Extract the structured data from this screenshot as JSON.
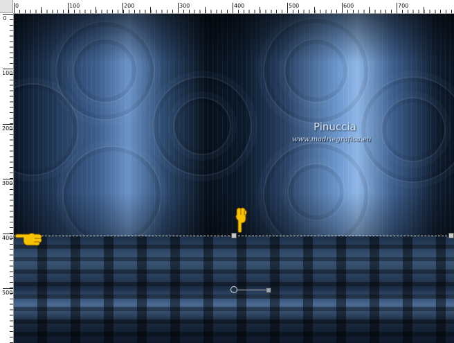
{
  "rulers": {
    "top_labels": [
      "0",
      "100",
      "200",
      "300",
      "400",
      "500",
      "600",
      "700"
    ],
    "left_labels": [
      "0",
      "100",
      "200",
      "300",
      "400",
      "500"
    ]
  },
  "canvas": {
    "watermark_title": "Pinuccia",
    "watermark_url": "www.madriegrafica.eu"
  },
  "icons": {
    "hand_pointer_left": "hand-pointer-icon",
    "hand_pointer_down": "hand-pointer-icon"
  },
  "colors": {
    "wall_highlight": "#8fb7e6",
    "wall_shadow": "#07101c",
    "floor_mid": "#3a5677",
    "hand_yellow": "#f7c300",
    "guide_line": "#e8e8e8"
  }
}
